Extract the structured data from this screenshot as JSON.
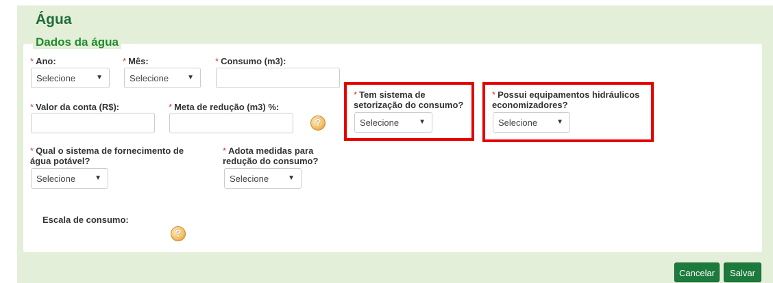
{
  "page": {
    "title": "Água"
  },
  "section": {
    "legend": "Dados da água"
  },
  "required_mark": "*",
  "fields": {
    "ano": {
      "label": "Ano:",
      "value": "Selecione"
    },
    "mes": {
      "label": "Mês:",
      "value": "Selecione"
    },
    "consumo": {
      "label": "Consumo (m3):",
      "value": ""
    },
    "valor_conta": {
      "label": "Valor da conta (R$):",
      "value": ""
    },
    "meta_reducao": {
      "label": "Meta de redução (m3) %:",
      "value": ""
    },
    "setorizacao": {
      "label_line1": "Tem sistema de",
      "label_line2": "setorização do consumo?",
      "value": "Selecione"
    },
    "equipamentos": {
      "label_line1": "Possui equipamentos hidráulicos",
      "label_line2": "economizadores?",
      "value": "Selecione"
    },
    "fornecimento": {
      "label_line1": "Qual o sistema de fornecimento de",
      "label_line2": "água potável?",
      "value": "Selecione"
    },
    "medidas": {
      "label_line1": "Adota medidas para",
      "label_line2": "redução do consumo?",
      "value": "Selecione"
    },
    "escala": {
      "label": "Escala de consumo:"
    }
  },
  "help_symbol": "?",
  "dropdown_arrow": "▼",
  "buttons": {
    "cancel": "Cancelar",
    "save": "Salvar"
  },
  "colors": {
    "highlight": "#e60000",
    "button": "#1c7a3c",
    "background": "#e3efd9"
  }
}
